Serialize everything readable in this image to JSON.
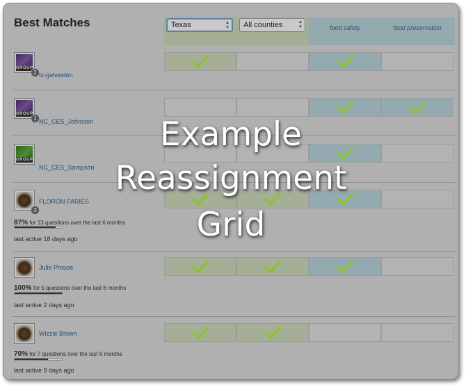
{
  "header": {
    "title": "Best Matches",
    "state_select": {
      "value": "Texas"
    },
    "county_select": {
      "value": "All counties"
    },
    "categories": [
      "food safety",
      "food preservation"
    ]
  },
  "rows": [
    {
      "name": "tx-galveston",
      "type": "group",
      "badge": "2",
      "checks": [
        true,
        false,
        true,
        false
      ]
    },
    {
      "name": "NC_CES_Johnston",
      "type": "group",
      "badge": "1",
      "checks": [
        false,
        false,
        true,
        true
      ]
    },
    {
      "name": "NC_CES_Sampson",
      "type": "group",
      "badge": "",
      "checks": [
        false,
        false,
        true,
        false
      ]
    },
    {
      "name": "FLORON FARIES",
      "type": "user",
      "badge": "3",
      "percent": "87%",
      "progress": 0.87,
      "stat_text": "for 13 questions over the last 6 months",
      "last_active": "last active 18 days ago",
      "checks": [
        true,
        true,
        true,
        false
      ]
    },
    {
      "name": "Julie Prouse",
      "type": "user",
      "badge": "",
      "percent": "100%",
      "progress": 1.0,
      "stat_text": "for 5 questions over the last 6 months",
      "last_active": "last active 2 days ago",
      "checks": [
        true,
        true,
        true,
        false
      ]
    },
    {
      "name": "Wizzie Brown",
      "type": "user",
      "badge": "",
      "percent": "70%",
      "progress": 0.7,
      "stat_text": "for 7 questions over the last 6 months",
      "last_active": "last active 9 days ago",
      "checks": [
        true,
        true,
        false,
        false
      ]
    }
  ],
  "group_tag": "GROUP",
  "overlay": {
    "lines": [
      "Example",
      "Reassignment",
      "Grid"
    ]
  },
  "colors": {
    "location_columns": "#a5ae96",
    "category_columns": "#93aab0",
    "check": "#8fc23a",
    "link": "#1e4f7a"
  },
  "icons": {
    "check": "check-icon",
    "select_arrows": "up-down-arrows-icon",
    "group_avatar": "group-image",
    "user_avatar": "pinecone-image"
  }
}
